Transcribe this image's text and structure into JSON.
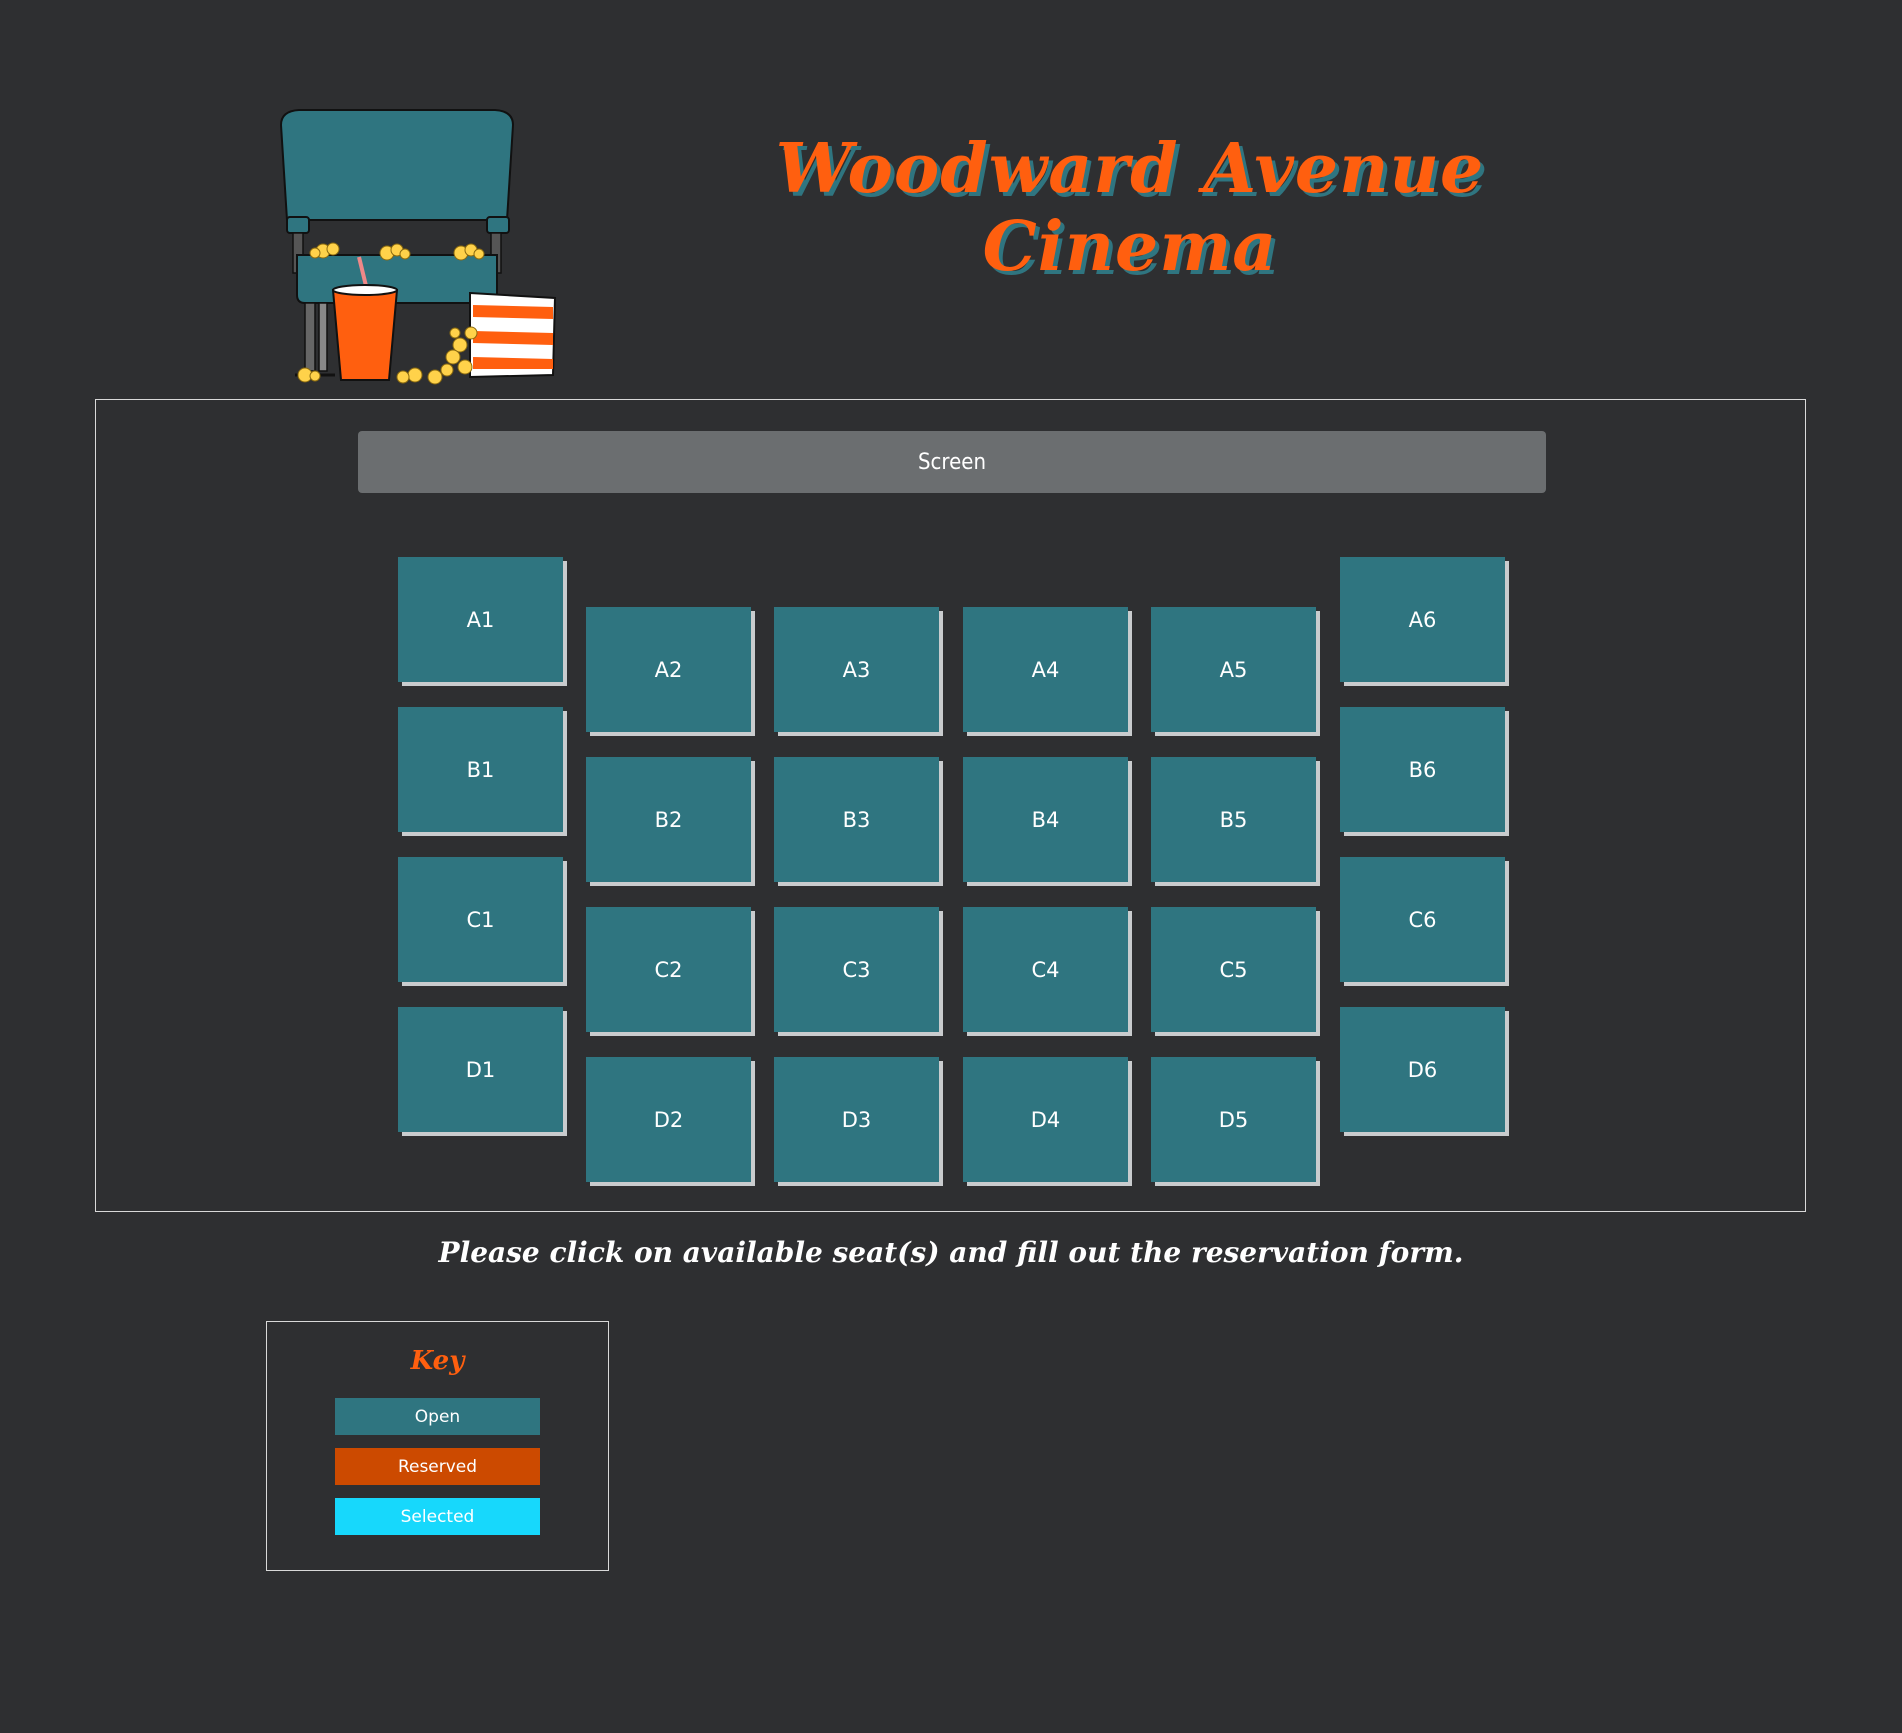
{
  "header": {
    "title_line1": "Woodward Avenue",
    "title_line2": "Cinema",
    "logo_icon": "cinema-seat-popcorn-icon"
  },
  "theater": {
    "screen_label": "Screen",
    "rows": [
      {
        "row": "A",
        "seats": [
          "A1",
          "A2",
          "A3",
          "A4",
          "A5",
          "A6"
        ]
      },
      {
        "row": "B",
        "seats": [
          "B1",
          "B2",
          "B3",
          "B4",
          "B5",
          "B6"
        ]
      },
      {
        "row": "C",
        "seats": [
          "C1",
          "C2",
          "C3",
          "C4",
          "C5",
          "C6"
        ]
      },
      {
        "row": "D",
        "seats": [
          "D1",
          "D2",
          "D3",
          "D4",
          "D5",
          "D6"
        ]
      }
    ],
    "seat_status": "open"
  },
  "instruction": "Please click on available seat(s) and fill out the reservation form.",
  "key": {
    "title": "Key",
    "items": [
      {
        "label": "Open",
        "color": "#2f7580"
      },
      {
        "label": "Reserved",
        "color": "#cc4a00"
      },
      {
        "label": "Selected",
        "color": "#17d8fc"
      }
    ]
  },
  "colors": {
    "background": "#2e2f31",
    "accent": "#ff5f0f",
    "seat_open": "#2f7580",
    "screen": "#6b6e70"
  }
}
